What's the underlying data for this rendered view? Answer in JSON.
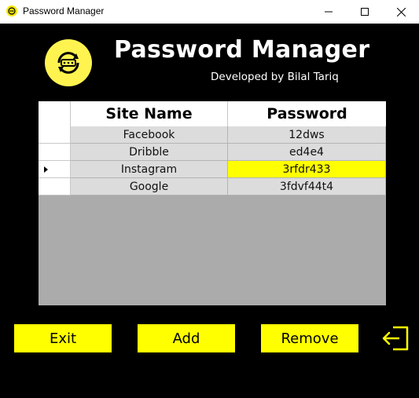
{
  "window": {
    "title": "Password Manager"
  },
  "header": {
    "title": "Password Manager",
    "subtitle": "Developed by Bilal Tariq"
  },
  "grid": {
    "columns": [
      "Site Name",
      "Password"
    ],
    "rows": [
      {
        "site": "Facebook",
        "password": "12dws"
      },
      {
        "site": "Dribble",
        "password": "ed4e4"
      },
      {
        "site": "Instagram",
        "password": "3rfdr433"
      },
      {
        "site": "Google",
        "password": "3fdvf44t4"
      }
    ],
    "selected_row": 2
  },
  "buttons": {
    "exit": "Exit",
    "add": "Add",
    "remove": "Remove"
  },
  "icons": {
    "app": "lock-refresh-icon",
    "exit": "exit-door-icon"
  },
  "colors": {
    "accent": "#ffff00",
    "background": "#000000",
    "grid_empty": "#ababab",
    "cell": "#dcdcdc"
  }
}
